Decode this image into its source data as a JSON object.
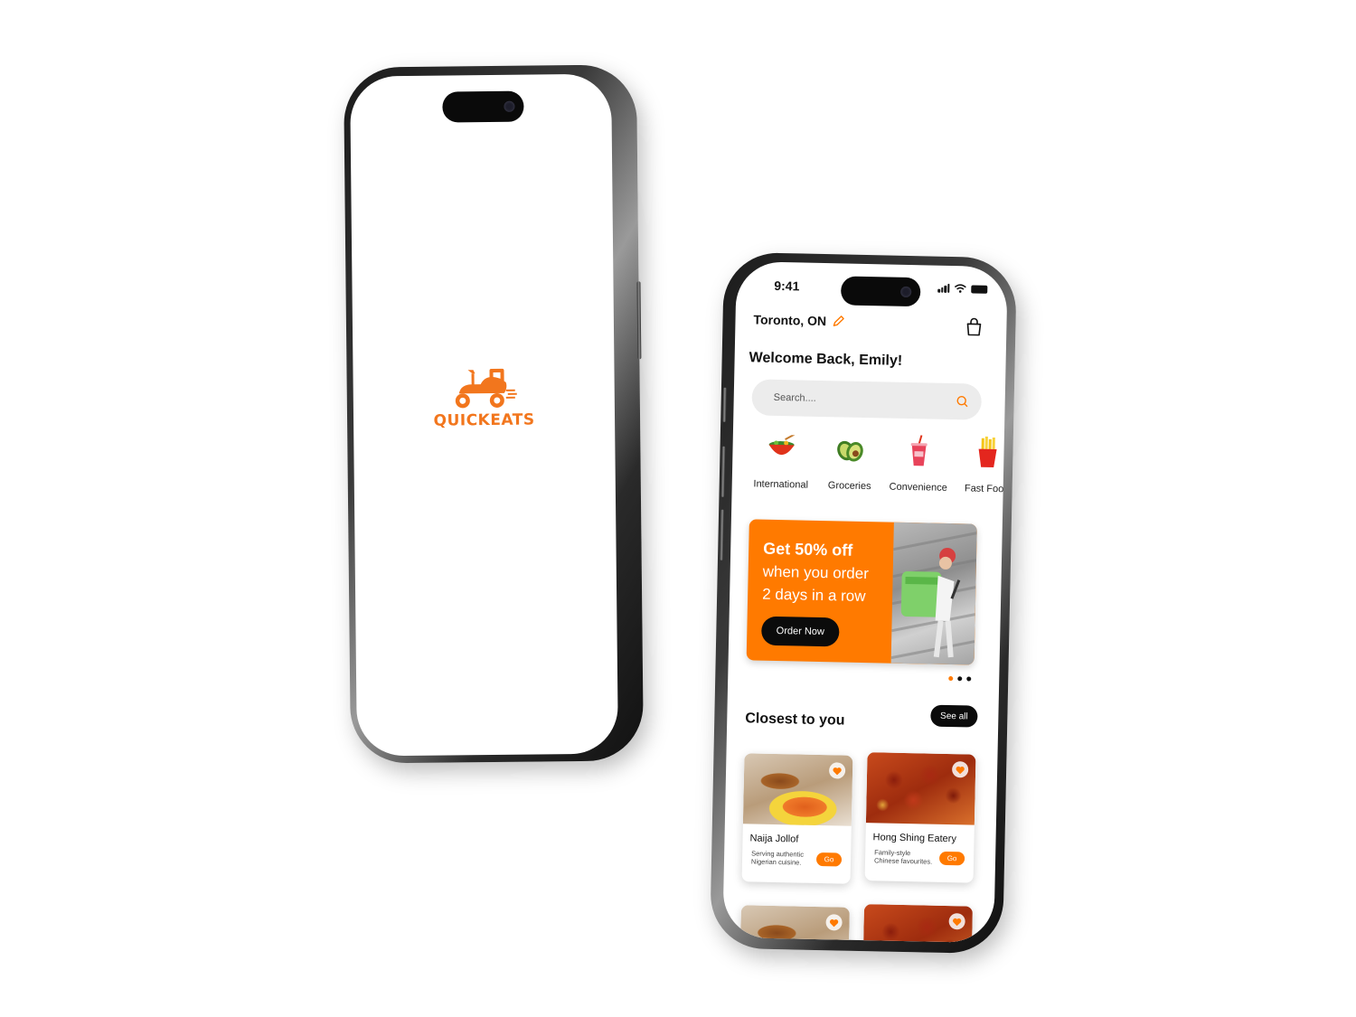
{
  "brand": {
    "name": "QUICKEATS",
    "accent": "#ff7a00",
    "logo_color": "#f2761d"
  },
  "status_bar": {
    "time": "9:41"
  },
  "header": {
    "location": "Toronto, ON",
    "edit_icon": "pencil-icon",
    "cart_icon": "shopping-bag-icon"
  },
  "welcome": "Welcome Back, Emily!",
  "search": {
    "placeholder": "Search....",
    "value": ""
  },
  "categories": [
    {
      "label": "International",
      "icon": "bowl-icon"
    },
    {
      "label": "Groceries",
      "icon": "avocado-icon"
    },
    {
      "label": "Convenience",
      "icon": "drink-cup-icon"
    },
    {
      "label": "Fast Food",
      "icon": "fries-icon"
    }
  ],
  "promo": {
    "headline": "Get 50% off",
    "line2": "when you order",
    "line3": "2 days in a row",
    "button": "Order Now"
  },
  "carousel": {
    "count": 3,
    "active": 0
  },
  "closest": {
    "title": "Closest to you",
    "see_all": "See all",
    "items": [
      {
        "name": "Naija Jollof",
        "desc": "Serving authentic Nigerian cuisine.",
        "button": "Go"
      },
      {
        "name": "Hong Shing Eatery",
        "desc": "Family-style Chinese favourites.",
        "button": "Go"
      }
    ]
  }
}
